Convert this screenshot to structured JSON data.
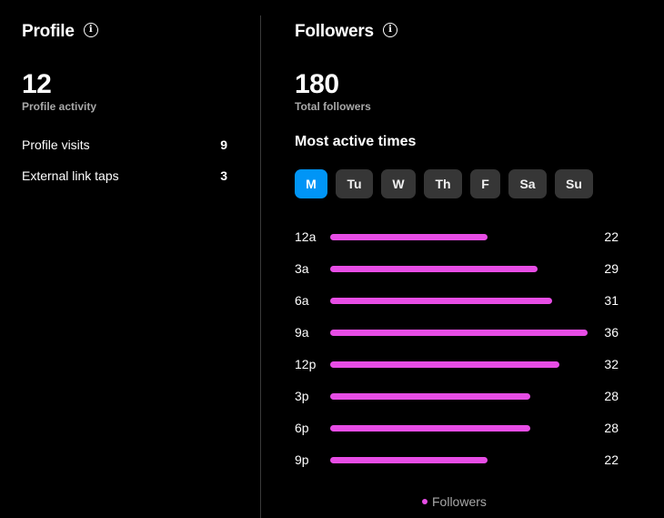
{
  "profile": {
    "title": "Profile",
    "info_icon": "info-icon",
    "activity_count": "12",
    "activity_label": "Profile activity",
    "stats": [
      {
        "label": "Profile visits",
        "value": "9"
      },
      {
        "label": "External link taps",
        "value": "3"
      }
    ]
  },
  "followers": {
    "title": "Followers",
    "info_icon": "info-icon",
    "total": "180",
    "total_label": "Total followers",
    "most_active_heading": "Most active times",
    "days": [
      {
        "label": "M",
        "selected": true
      },
      {
        "label": "Tu",
        "selected": false
      },
      {
        "label": "W",
        "selected": false
      },
      {
        "label": "Th",
        "selected": false
      },
      {
        "label": "F",
        "selected": false
      },
      {
        "label": "Sa",
        "selected": false
      },
      {
        "label": "Su",
        "selected": false
      }
    ]
  },
  "colors": {
    "bar": "#e74de5",
    "accent": "#0095f6",
    "day_inactive": "#363636"
  },
  "chart_data": {
    "type": "bar",
    "orientation": "horizontal",
    "categories": [
      "12a",
      "3a",
      "6a",
      "9a",
      "12p",
      "3p",
      "6p",
      "9p"
    ],
    "series": [
      {
        "name": "Followers",
        "values": [
          22,
          29,
          31,
          36,
          32,
          28,
          28,
          22
        ]
      }
    ],
    "xlim": [
      0,
      36
    ],
    "legend": "bottom-center",
    "grid": false
  }
}
